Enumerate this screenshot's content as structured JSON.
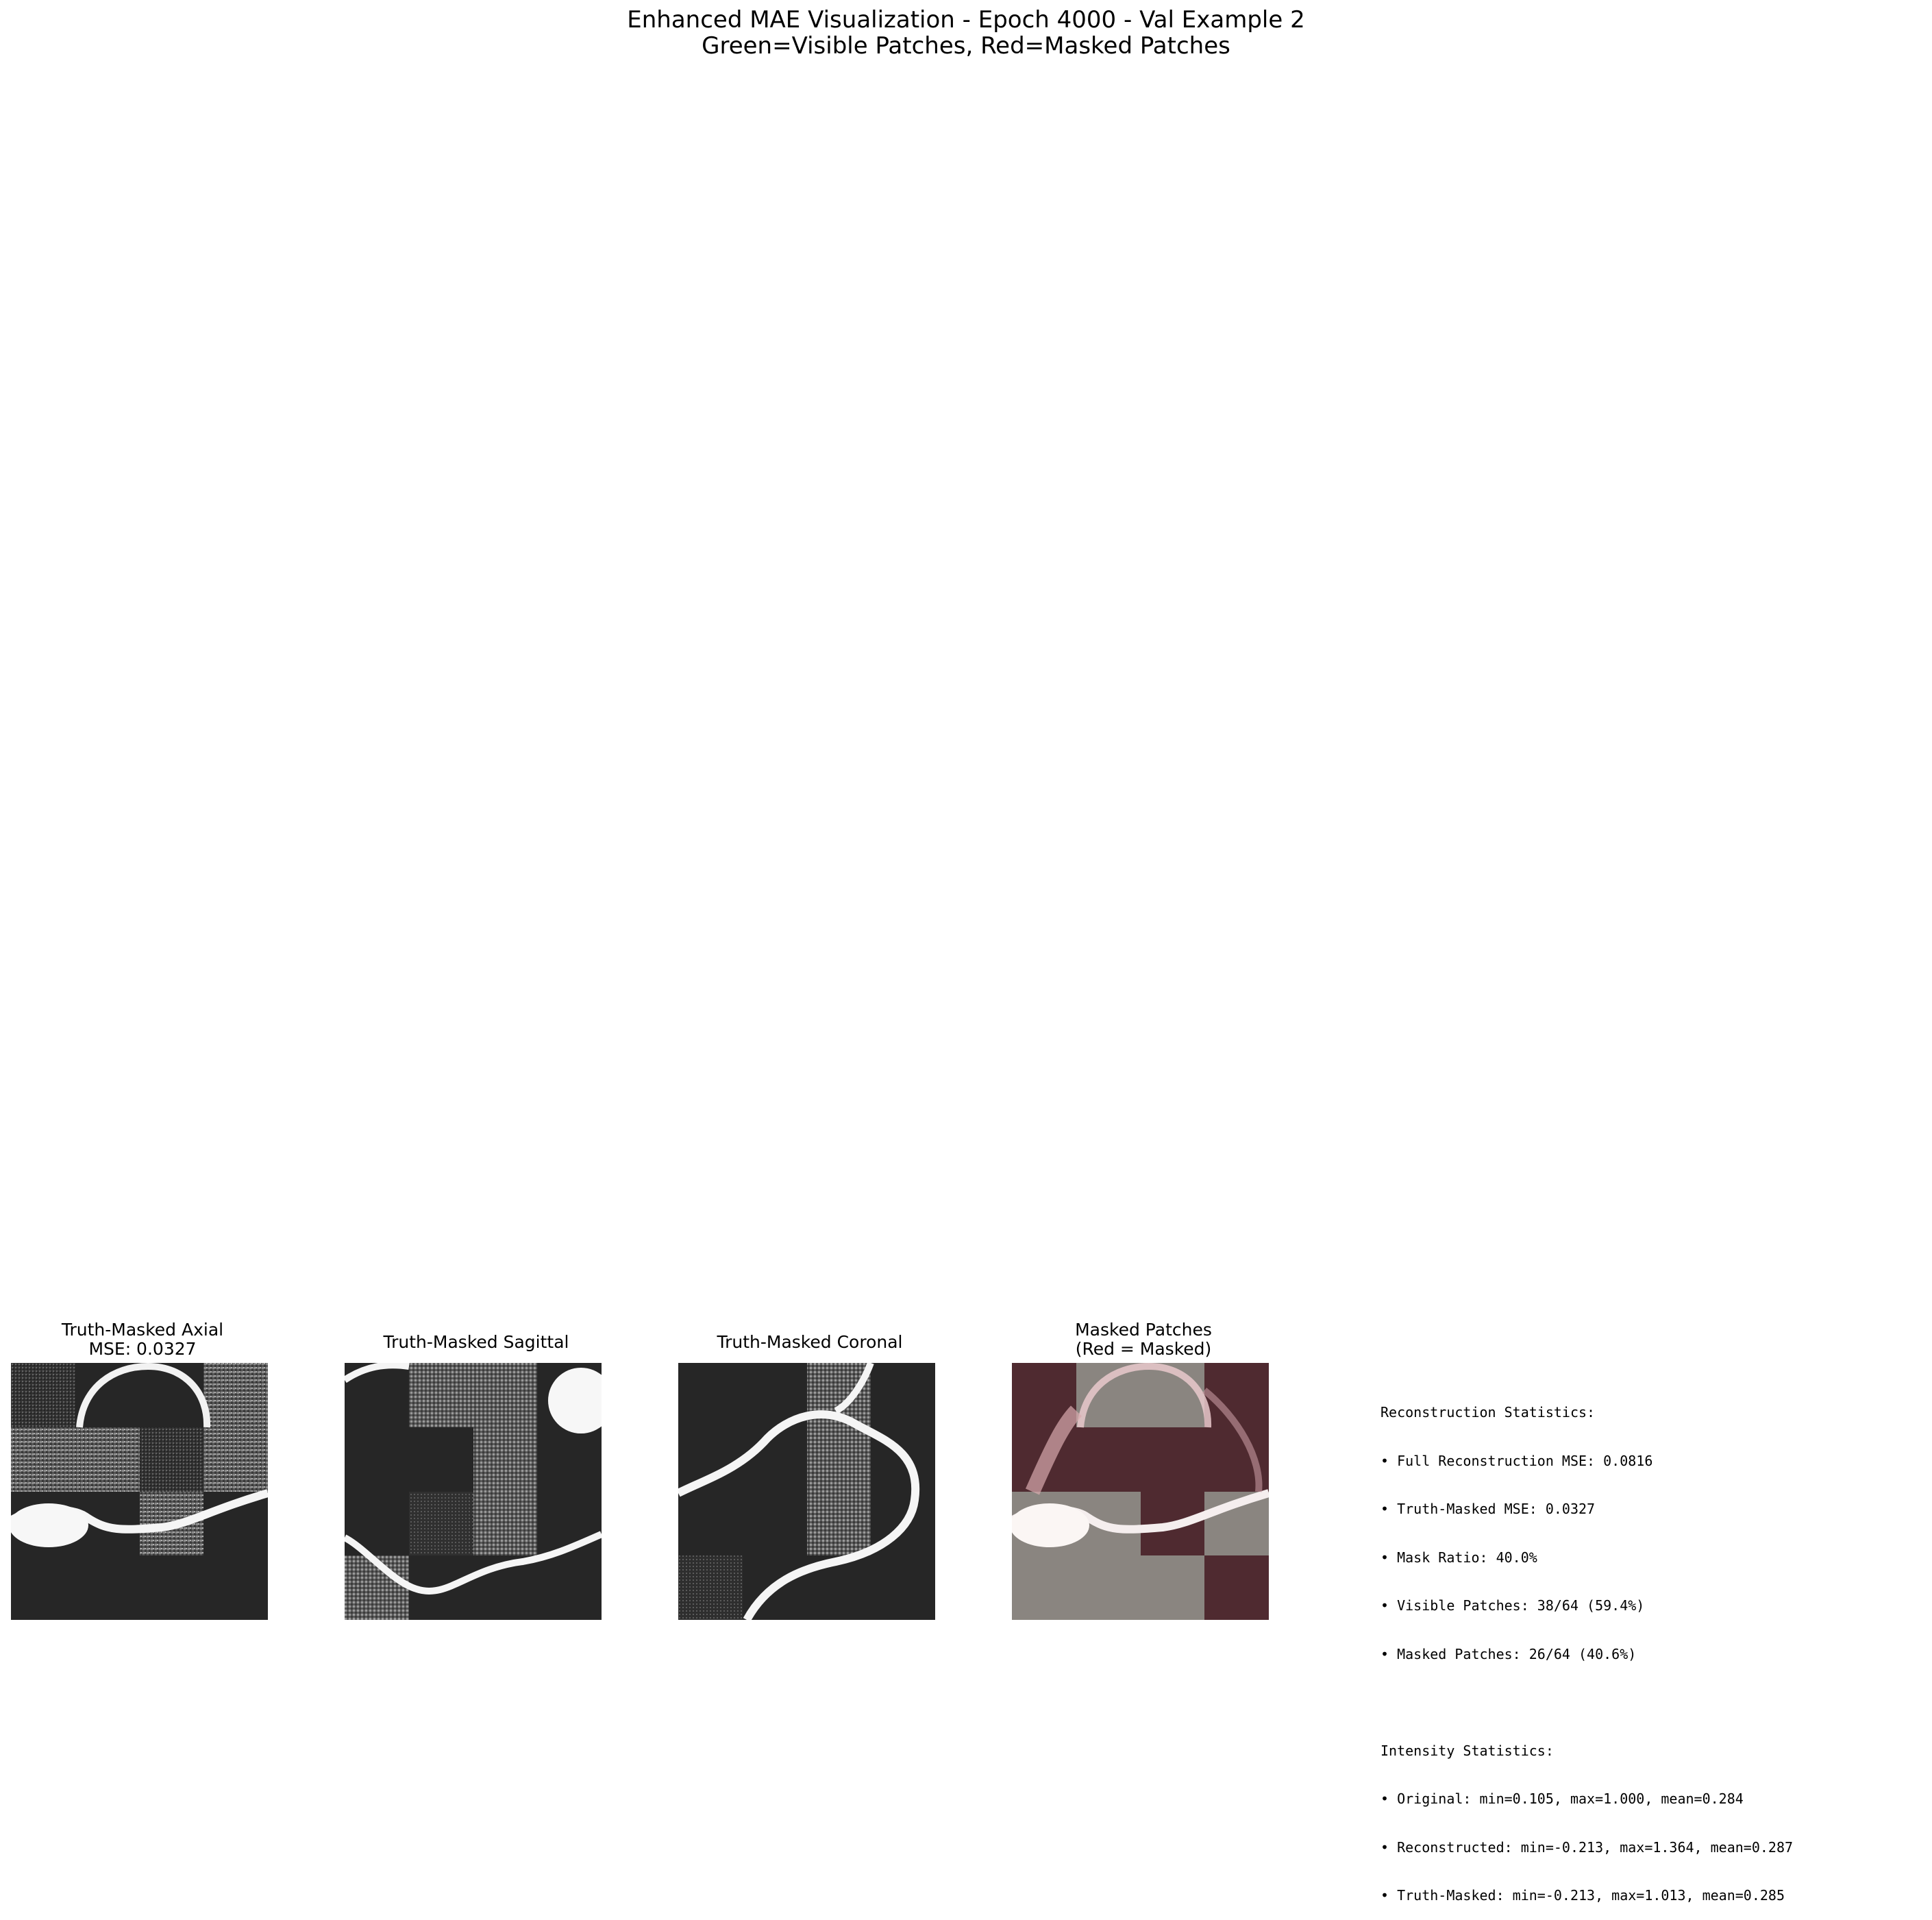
{
  "figure": {
    "title_line1": "Enhanced MAE Visualization - Epoch 4000 - Val Example 2",
    "title_line2": "Green=Visible Patches, Red=Masked Patches"
  },
  "panels": [
    {
      "title_line1": "Truth-Masked Axial",
      "title_line2": "MSE: 0.0327"
    },
    {
      "title_line1": "Truth-Masked Sagittal",
      "title_line2": ""
    },
    {
      "title_line1": "Truth-Masked Coronal",
      "title_line2": ""
    },
    {
      "title_line1": "Masked Patches",
      "title_line2": "(Red = Masked)"
    }
  ],
  "colors": {
    "background_dark": "#262626",
    "visible_overlay": "#8a8580",
    "masked_overlay": "#4f2a30",
    "curve": "#f7f7f7"
  },
  "stats": {
    "recon_header": "Reconstruction Statistics:",
    "recon_lines": [
      "• Full Reconstruction MSE: 0.0816",
      "• Truth-Masked MSE: 0.0327",
      "• Mask Ratio: 40.0%",
      "• Visible Patches: 38/64 (59.4%)",
      "• Masked Patches: 26/64 (40.6%)"
    ],
    "intensity_header": "Intensity Statistics:",
    "intensity_lines": [
      "• Original: min=0.105, max=1.000, mean=0.284",
      "• Reconstructed: min=-0.213, max=1.364, mean=0.287",
      "• Truth-Masked: min=-0.213, max=1.013, mean=0.285"
    ]
  }
}
